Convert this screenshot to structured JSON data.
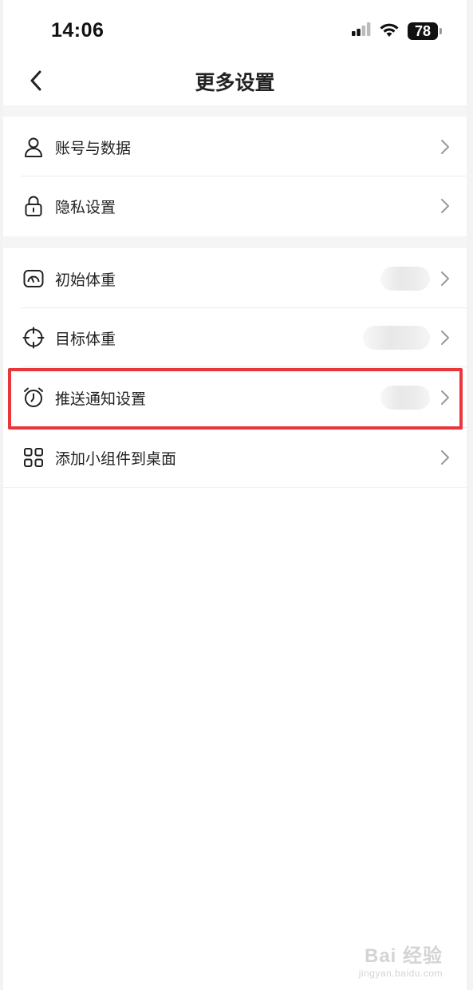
{
  "status_bar": {
    "time": "14:06",
    "battery": "78",
    "icons": [
      "cellular-signal-icon",
      "wifi-icon",
      "battery-icon"
    ]
  },
  "nav": {
    "title": "更多设置",
    "back_icon": "chevron-left-icon"
  },
  "groups": [
    {
      "items": [
        {
          "label": "账号与数据",
          "icon": "user-icon"
        },
        {
          "label": "隐私设置",
          "icon": "lock-icon"
        }
      ]
    },
    {
      "items": [
        {
          "label": "初始体重",
          "icon": "scale-icon",
          "value": ""
        },
        {
          "label": "目标体重",
          "icon": "target-icon",
          "value": ""
        },
        {
          "label": "推送通知设置",
          "icon": "alarm-clock-icon",
          "value": "",
          "highlighted": true
        },
        {
          "label": "添加小组件到桌面",
          "icon": "grid-icon"
        }
      ]
    }
  ],
  "highlight_color": "#e8363b",
  "watermark": {
    "main": "Bai 经验",
    "sub": "jingyan.baidu.com"
  }
}
